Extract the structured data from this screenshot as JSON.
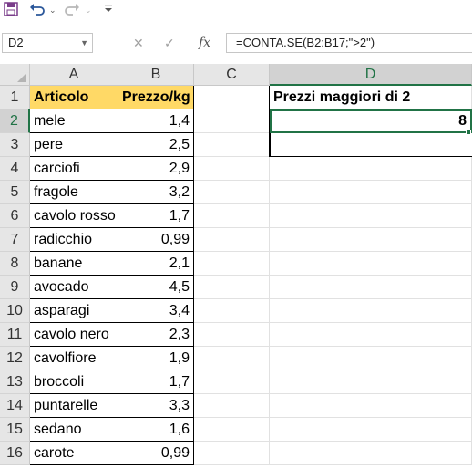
{
  "qat": {
    "save_icon": "save-icon",
    "undo_icon": "undo-icon",
    "redo_icon": "redo-icon",
    "customize_icon": "customize-icon"
  },
  "formula_bar": {
    "name_box": "D2",
    "cancel_glyph": "✕",
    "enter_glyph": "✓",
    "fx_glyph": "fx",
    "formula": "=CONTA.SE(B2:B17;\">2\")"
  },
  "columns": [
    "A",
    "B",
    "C",
    "D"
  ],
  "rows": [
    "1",
    "2",
    "3",
    "4",
    "5",
    "6",
    "7",
    "8",
    "9",
    "10",
    "11",
    "12",
    "13",
    "14",
    "15",
    "16"
  ],
  "table": {
    "header": [
      "Articolo",
      "Prezzo/kg"
    ],
    "items": [
      {
        "name": "mele",
        "price": "1,4"
      },
      {
        "name": "pere",
        "price": "2,5"
      },
      {
        "name": "carciofi",
        "price": "2,9"
      },
      {
        "name": "fragole",
        "price": "3,2"
      },
      {
        "name": "cavolo rosso",
        "price": "1,7"
      },
      {
        "name": "radicchio",
        "price": "0,99"
      },
      {
        "name": "banane",
        "price": "2,1"
      },
      {
        "name": "avocado",
        "price": "4,5"
      },
      {
        "name": "asparagi",
        "price": "3,4"
      },
      {
        "name": "cavolo nero",
        "price": "2,3"
      },
      {
        "name": "cavolfiore",
        "price": "1,9"
      },
      {
        "name": "broccoli",
        "price": "1,7"
      },
      {
        "name": "puntarelle",
        "price": "3,3"
      },
      {
        "name": "sedano",
        "price": "1,6"
      },
      {
        "name": "carote",
        "price": "0,99"
      }
    ]
  },
  "result": {
    "label": "Prezzi maggiori di 2",
    "value": "8"
  },
  "colors": {
    "header_fill": "#ffd966",
    "accent": "#217346"
  }
}
